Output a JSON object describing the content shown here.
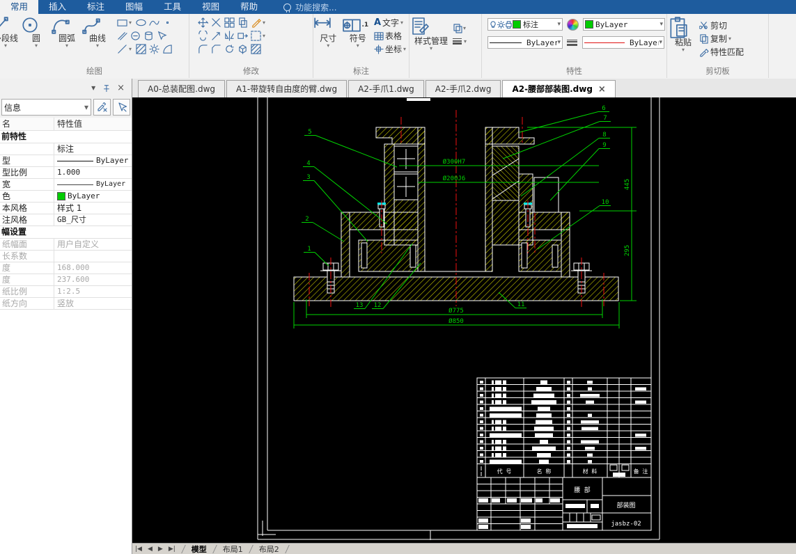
{
  "ribbon": {
    "tabs": [
      "常用",
      "插入",
      "标注",
      "图幅",
      "工具",
      "视图",
      "帮助"
    ],
    "active_tab": "常用",
    "search": "功能搜索...",
    "draw": {
      "label": "绘图",
      "tools": [
        "多段线",
        "圆",
        "圆弧",
        "曲线"
      ]
    },
    "modify": {
      "label": "修改"
    },
    "annotate": {
      "label": "标注",
      "dim": "尺寸",
      "symbol": "符号",
      "text": "文字",
      "table": "表格",
      "coord": "坐标",
      "text_icon": "A",
      "symbol_icon_text": ".1"
    },
    "style": {
      "manager": "样式管理"
    },
    "props": {
      "label": "特性",
      "layer": "标注",
      "color_value": "ByLayer",
      "linetype_value": "ByLayer",
      "linetype2_value": "ByLayer",
      "swatch_color": "#00cc00",
      "line_red": "#e01010"
    },
    "clip": {
      "label": "剪切板",
      "paste": "粘贴",
      "cut": "剪切",
      "copy": "复制",
      "match": "特性匹配"
    }
  },
  "doc_tabs": [
    "A0-总装配图.dwg",
    "A1-带旋转自由度的臂.dwg",
    "A2-手爪1.dwg",
    "A2-手爪2.dwg",
    "A2-腰部部装图.dwg"
  ],
  "active_doc_tab": "A2-腰部部装图.dwg",
  "palette": {
    "combo": "信息",
    "header": {
      "name": "名",
      "value": "特性值"
    },
    "sec1": "前特性",
    "rows1": [
      {
        "label": "",
        "value": "标注"
      },
      {
        "label": "型",
        "value": "ByLayer"
      },
      {
        "label": "型比例",
        "value": "1.000"
      },
      {
        "label": "宽",
        "value": "ByLayer"
      },
      {
        "label": "色",
        "value": "ByLayer",
        "swatch": "#00cc00"
      },
      {
        "label": "本风格",
        "value": "样式 1"
      },
      {
        "label": "注风格",
        "value": "GB_尺寸"
      }
    ],
    "sec2": "幅设置",
    "rows2": [
      {
        "label": "纸幅面",
        "value": "用户自定义"
      },
      {
        "label": "长系数",
        "value": ""
      },
      {
        "label": "度",
        "value": "168.000"
      },
      {
        "label": "度",
        "value": "237.600"
      },
      {
        "label": "纸比例",
        "value": "1:2.5"
      },
      {
        "label": "纸方向",
        "value": "竖放"
      }
    ]
  },
  "drawing": {
    "dims": {
      "bore1": "Ø300H7",
      "bore2": "Ø200J6",
      "base1": "Ø775",
      "base2": "Ø850",
      "h1": "445",
      "h2": "295"
    },
    "balloons": [
      "1",
      "2",
      "3",
      "4",
      "5",
      "6",
      "7",
      "8",
      "9",
      "10",
      "11",
      "12",
      "13"
    ],
    "colors": {
      "hatch": "#d6d600",
      "outline": "#ffffff",
      "dim": "#00d400",
      "centerline": "#ee1111",
      "mark": "#00e5e5"
    },
    "titleblock": {
      "h_code": "代 号",
      "h_name": "名 称",
      "h_mat": "材 料",
      "h_note": "备 注",
      "part": "腰  部",
      "doc": "部装图",
      "num": "jasbz-02"
    }
  },
  "statusbar": {
    "tabs": [
      "模型",
      "布局1",
      "布局2"
    ]
  }
}
